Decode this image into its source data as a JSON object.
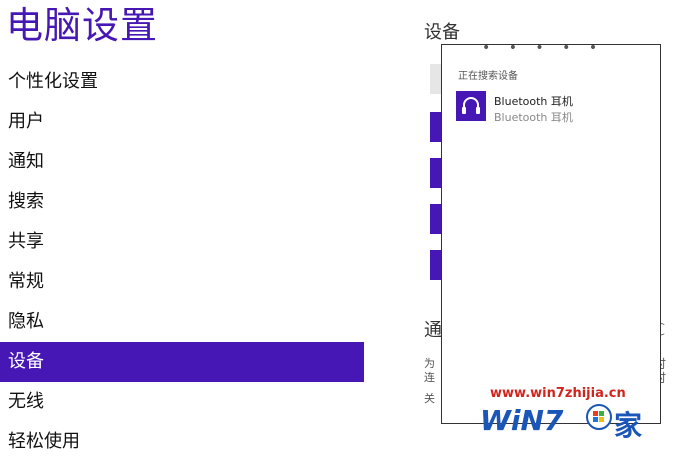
{
  "app": {
    "title": "电脑设置"
  },
  "nav": {
    "items": [
      {
        "label": "个性化设置"
      },
      {
        "label": "用户"
      },
      {
        "label": "通知"
      },
      {
        "label": "搜索"
      },
      {
        "label": "共享"
      },
      {
        "label": "常规"
      },
      {
        "label": "隐私"
      },
      {
        "label": "设备",
        "selected": true
      },
      {
        "label": "无线"
      },
      {
        "label": "轻松使用"
      }
    ]
  },
  "devices_section": {
    "title": "设备",
    "partial_heading": "通",
    "partial_heading_right": "ℂ",
    "partial_text_1": "为",
    "partial_text_2": "连",
    "partial_text_3": "关",
    "partial_right_1": "时",
    "partial_right_2": "时"
  },
  "popup": {
    "status": "正在搜索设备",
    "devices": [
      {
        "name": "Bluetooth 耳机",
        "subtitle": "Bluetooth 耳机",
        "icon": "headset-icon"
      }
    ]
  },
  "watermark": {
    "url": "www.win7zhijia.cn",
    "logo": "WiN7",
    "tail": "家"
  },
  "colors": {
    "accent": "#4617b4",
    "watermark_red": "#d0241c",
    "watermark_blue": "#1a55b8"
  }
}
